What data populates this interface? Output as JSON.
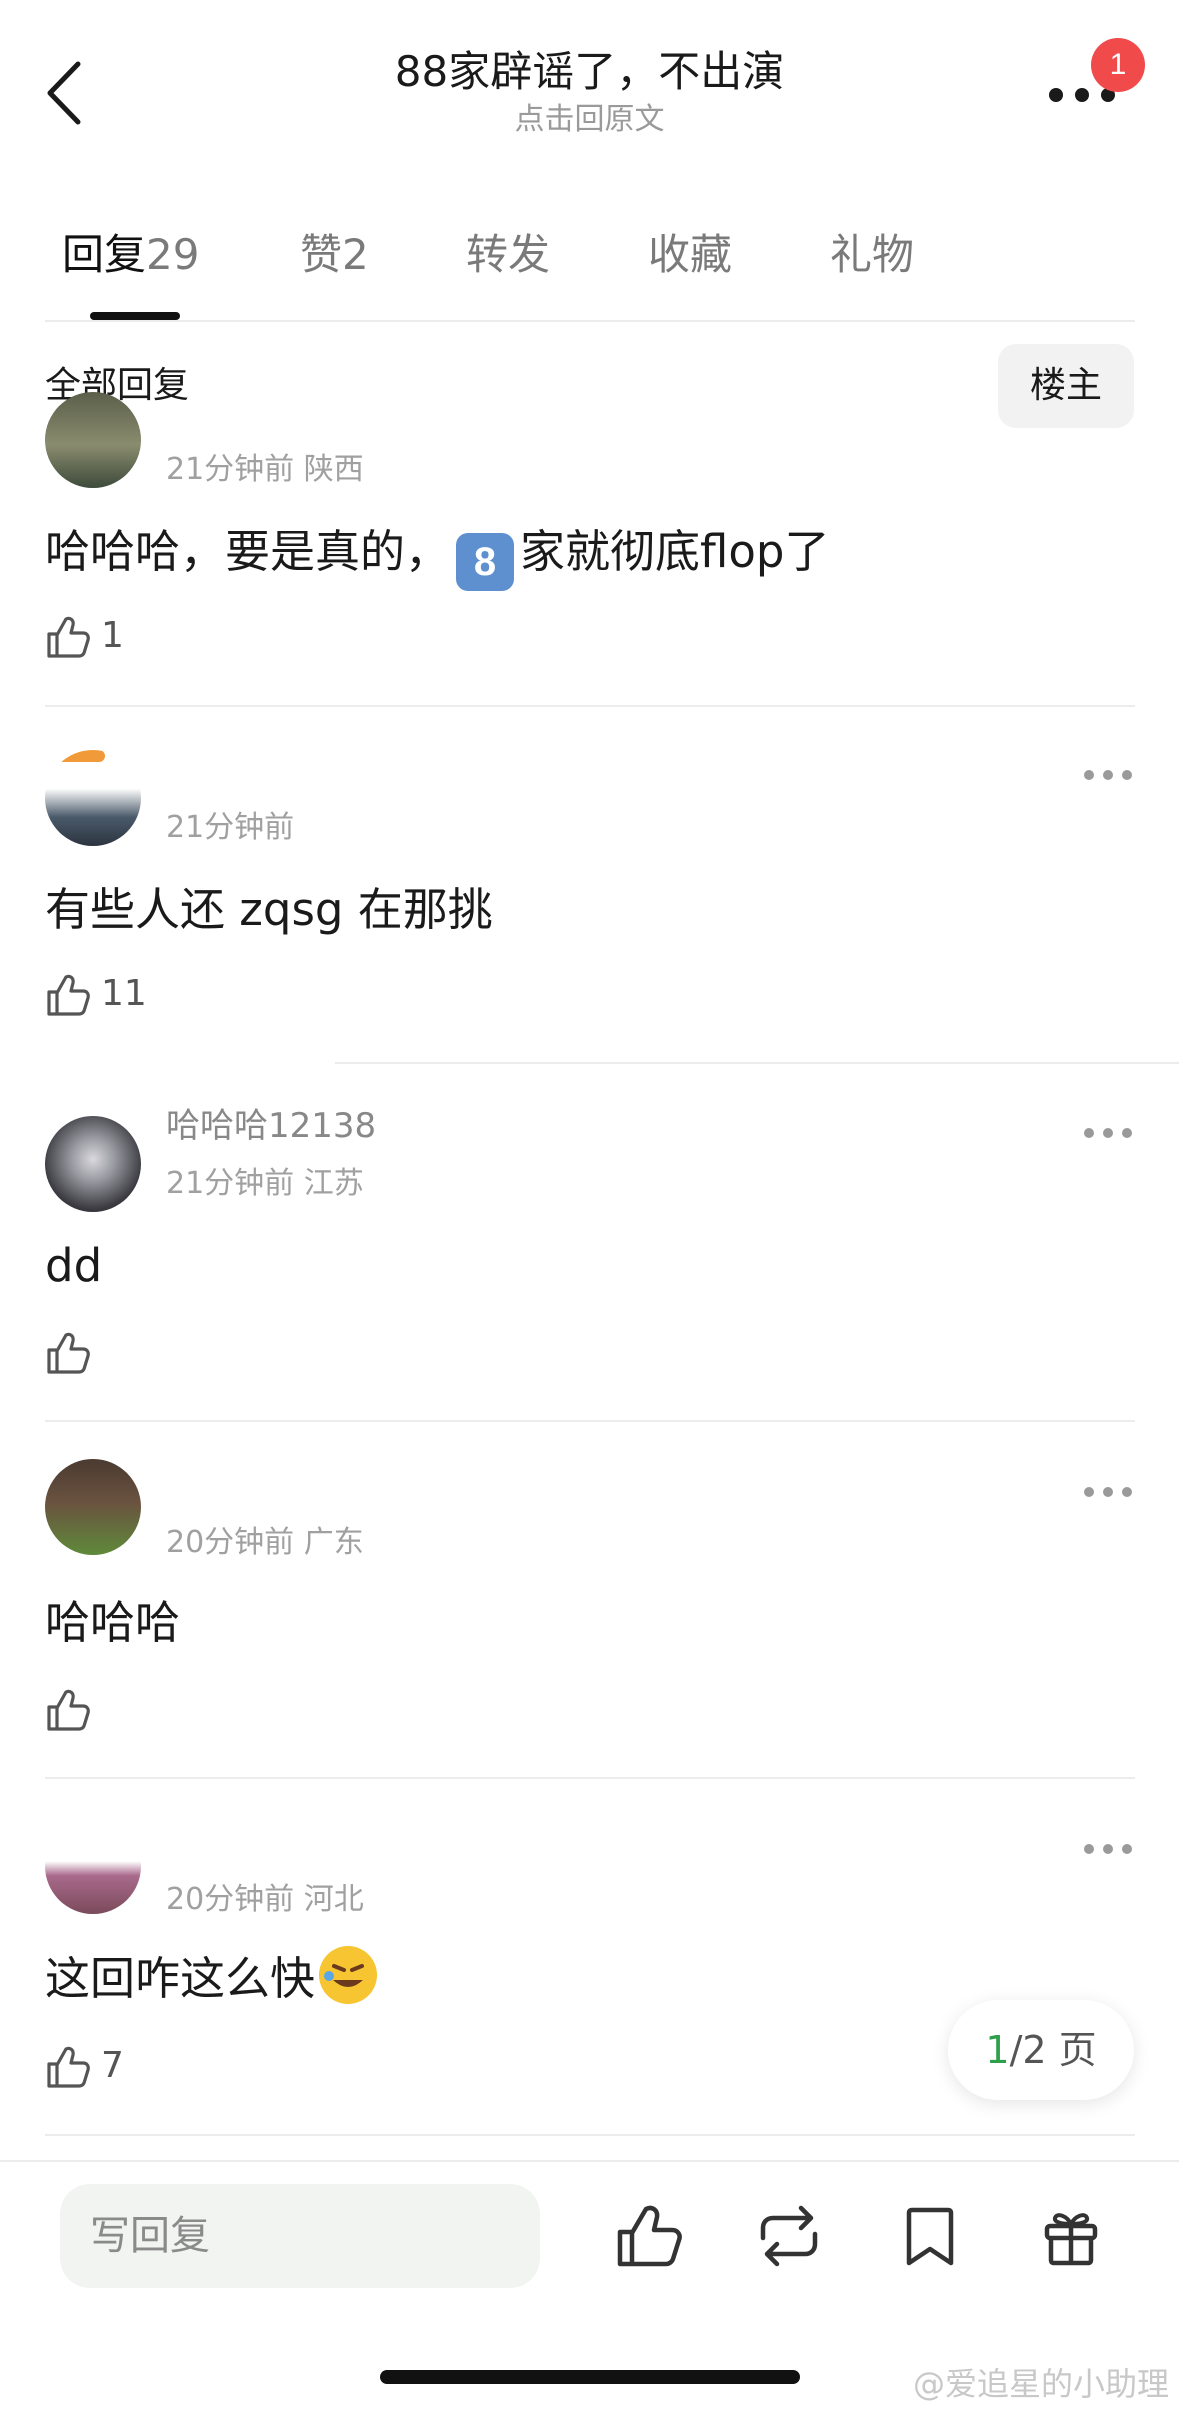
{
  "header": {
    "title": "88家辟谣了，不出演",
    "subtitle": "点击回原文",
    "badge_count": "1"
  },
  "tabs": [
    {
      "label": "回复",
      "count": "29"
    },
    {
      "label": "赞",
      "count": "2"
    },
    {
      "label": "转发",
      "count": ""
    },
    {
      "label": "收藏",
      "count": ""
    },
    {
      "label": "礼物",
      "count": ""
    }
  ],
  "filter": {
    "label": "全部回复",
    "host_button": "楼主"
  },
  "comments": [
    {
      "username": "",
      "time": "21分钟前",
      "location": "陕西",
      "text_before": "哈哈哈，要是真的，",
      "emoji": "8",
      "text_after": "家就彻底flop了",
      "likes": "1"
    },
    {
      "username": "",
      "time": "21分钟前",
      "location": "",
      "text": "有些人还 zqsg 在那挑",
      "likes": "11"
    },
    {
      "username": "哈哈哈12138",
      "time": "21分钟前",
      "location": "江苏",
      "text": "dd",
      "likes": ""
    },
    {
      "username": "",
      "time": "20分钟前",
      "location": "广东",
      "text": "哈哈哈",
      "likes": ""
    },
    {
      "username": "",
      "time": "20分钟前",
      "location": "河北",
      "text": "这回咋这么快",
      "likes": "7"
    }
  ],
  "pager": {
    "current": "1",
    "total_text": "/2 页"
  },
  "bottom_bar": {
    "reply_placeholder": "写回复"
  },
  "watermark": "@爱追星的小助理",
  "colors": {
    "accent_green": "#2e9f4b",
    "badge_red": "#f04a4a"
  }
}
